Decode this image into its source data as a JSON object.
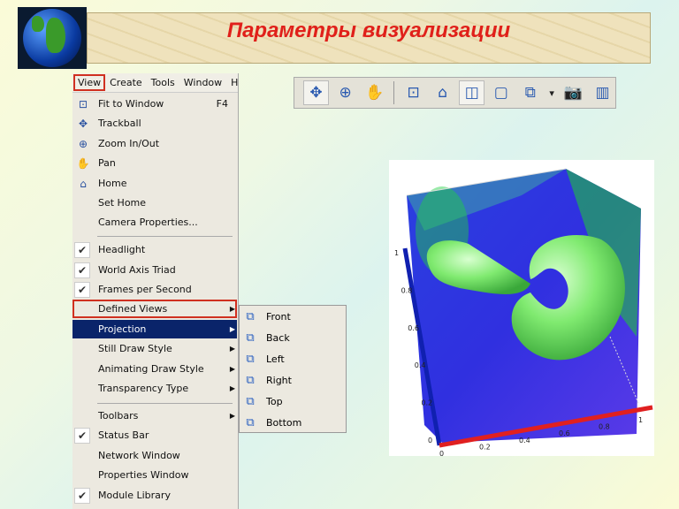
{
  "slide": {
    "title": "Параметры визуализации"
  },
  "menubar": [
    "View",
    "Create",
    "Tools",
    "Window",
    "H"
  ],
  "view_menu": {
    "items": [
      {
        "label": "Fit to Window",
        "shortcut": "F4",
        "icon": "fit-window-icon"
      },
      {
        "label": "Trackball",
        "icon": "trackball-icon"
      },
      {
        "label": "Zoom In/Out",
        "icon": "zoom-icon"
      },
      {
        "label": "Pan",
        "icon": "hand-icon"
      },
      {
        "label": "Home",
        "icon": "home-icon"
      },
      {
        "label": "Set Home"
      },
      {
        "label": "Camera Properties..."
      },
      {
        "label": "Headlight",
        "checked": true
      },
      {
        "label": "World Axis Triad",
        "checked": true
      },
      {
        "label": "Frames per Second",
        "checked": true
      },
      {
        "label": "Defined Views",
        "submenu": true
      },
      {
        "label": "Projection",
        "submenu": true,
        "highlighted": true
      },
      {
        "label": "Still Draw Style",
        "submenu": true
      },
      {
        "label": "Animating Draw Style",
        "submenu": true
      },
      {
        "label": "Transparency Type",
        "submenu": true
      },
      {
        "label": "Toolbars",
        "submenu": true
      },
      {
        "label": "Status Bar",
        "checked": true
      },
      {
        "label": "Network Window"
      },
      {
        "label": "Properties Window"
      },
      {
        "label": "Module Library",
        "checked": true
      }
    ]
  },
  "defined_views_submenu": [
    "Front",
    "Back",
    "Left",
    "Right",
    "Top",
    "Bottom"
  ],
  "toolbar": [
    "trackball-icon",
    "zoom-icon",
    "pan-icon",
    "fit-window-icon",
    "home-icon",
    "perspective-icon",
    "orthographic-icon",
    "wireframe-cube-icon",
    "dropdown-arrow-icon",
    "camera-icon",
    "film-icon"
  ],
  "visualization": {
    "x_ticks": [
      "0",
      "0.2",
      "0.4",
      "0.6",
      "0.8",
      "1"
    ],
    "y_ticks": [
      "0",
      "0.2",
      "0.4",
      "0.6",
      "0.8",
      "1"
    ],
    "colors": {
      "surface": "#66e066",
      "background_field": "#2a2ae8",
      "x_axis": "#e02020",
      "y_axis": "#1020b0"
    }
  }
}
